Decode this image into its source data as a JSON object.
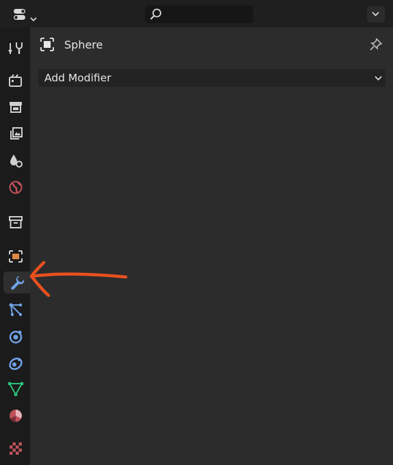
{
  "header": {
    "editor_type_icon": "properties-editor-icon",
    "search_placeholder": ""
  },
  "object": {
    "name": "Sphere",
    "icon": "object-icon"
  },
  "modifier": {
    "add_label": "Add Modifier"
  },
  "sidebar": {
    "tabs": [
      {
        "name": "tool",
        "icon": "tool-icon",
        "active": false
      },
      {
        "name": "render",
        "icon": "render-icon",
        "active": false
      },
      {
        "name": "output",
        "icon": "output-icon",
        "active": false
      },
      {
        "name": "view-layer",
        "icon": "view-layer-icon",
        "active": false
      },
      {
        "name": "scene",
        "icon": "scene-icon",
        "active": false
      },
      {
        "name": "world",
        "icon": "world-icon",
        "active": false
      },
      {
        "name": "collection",
        "icon": "collection-icon",
        "active": false
      },
      {
        "name": "object",
        "icon": "object-icon",
        "active": false
      },
      {
        "name": "modifiers",
        "icon": "wrench-icon",
        "active": true
      },
      {
        "name": "particles",
        "icon": "particles-icon",
        "active": false
      },
      {
        "name": "physics",
        "icon": "physics-icon",
        "active": false
      },
      {
        "name": "constraints",
        "icon": "constraints-icon",
        "active": false
      },
      {
        "name": "data",
        "icon": "mesh-data-icon",
        "active": false
      },
      {
        "name": "material",
        "icon": "material-icon",
        "active": false
      },
      {
        "name": "texture",
        "icon": "texture-icon",
        "active": false
      }
    ]
  },
  "colors": {
    "annotation_arrow": "#e8501e",
    "active_tab_icon": "#6fa3e8",
    "object_orange": "#e08a43",
    "world_red": "#c0515a",
    "mesh_green": "#2bc07b"
  }
}
